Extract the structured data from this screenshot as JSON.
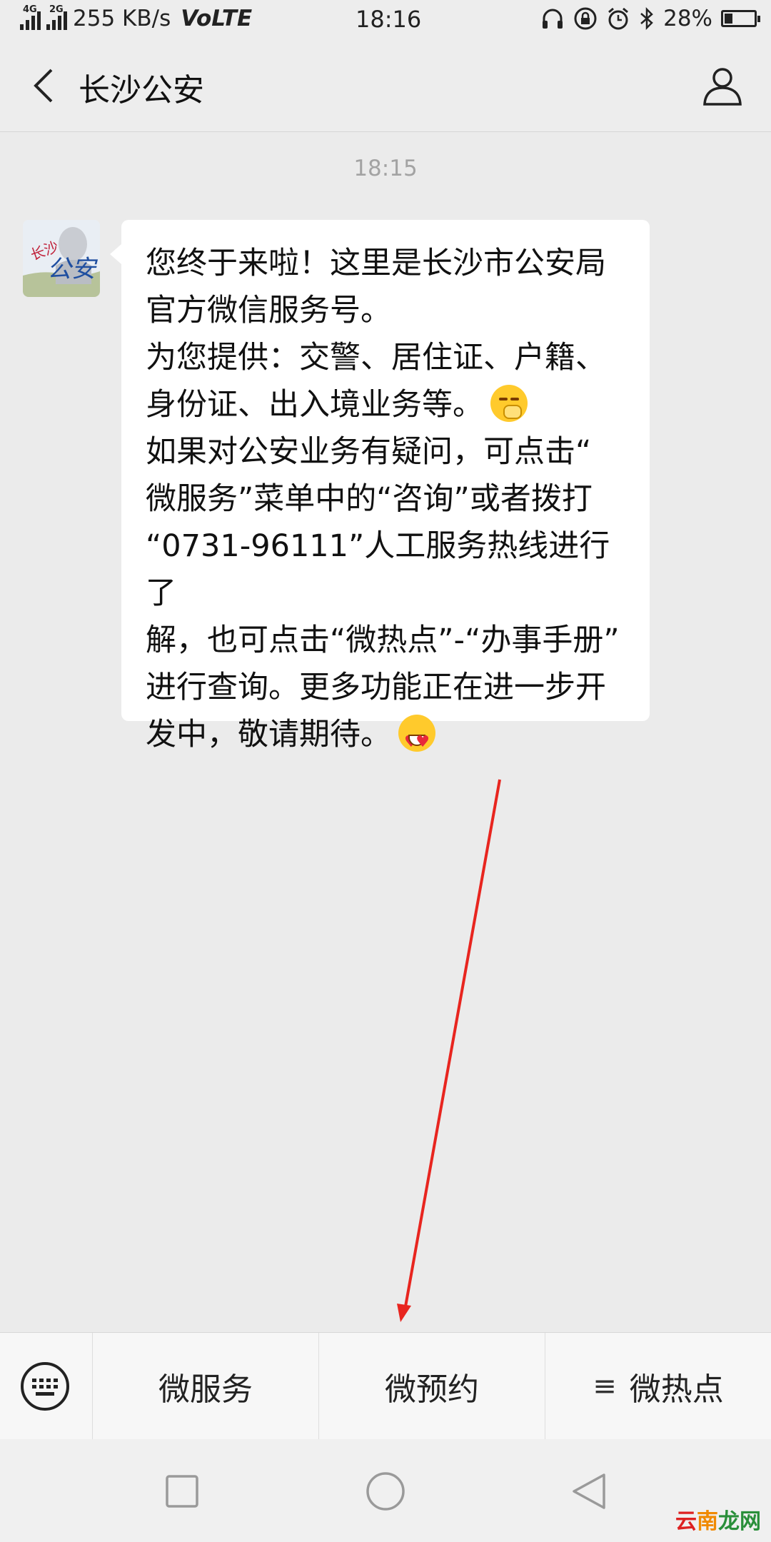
{
  "status_bar": {
    "network_4g": "4G",
    "network_2g": "2G",
    "speed": "255 KB/s",
    "volte": "VoLTE",
    "time": "18:16",
    "battery_percent": "28%",
    "battery_level": 0.28
  },
  "header": {
    "title": "长沙公安"
  },
  "chat": {
    "timestamp": "18:15",
    "avatar_logo_text": "长沙公安",
    "message_lines": [
      "您终于来啦！这里是长沙市公安局",
      "官方微信服务号。",
      "为您提供：交警、居住证、户籍、",
      "身份证、出入境业务等。",
      "如果对公安业务有疑问，可点击“",
      "微服务”菜单中的“咨询”或者拨打",
      "“0731-96111”人工服务热线进行了",
      "解，也可点击“微热点”-“办事手册”",
      "进行查询。更多功能正在进一步开",
      "发中，敬请期待。"
    ]
  },
  "menu": {
    "items": [
      {
        "label": "微服务"
      },
      {
        "label": "微预约"
      },
      {
        "label": "微热点",
        "icon": "≡"
      }
    ]
  },
  "watermark": {
    "part1": "云",
    "part2": "南",
    "part3": "龙网"
  },
  "colors": {
    "background": "#ebebeb",
    "bubble": "#ffffff",
    "arrow": "#e8251f"
  }
}
